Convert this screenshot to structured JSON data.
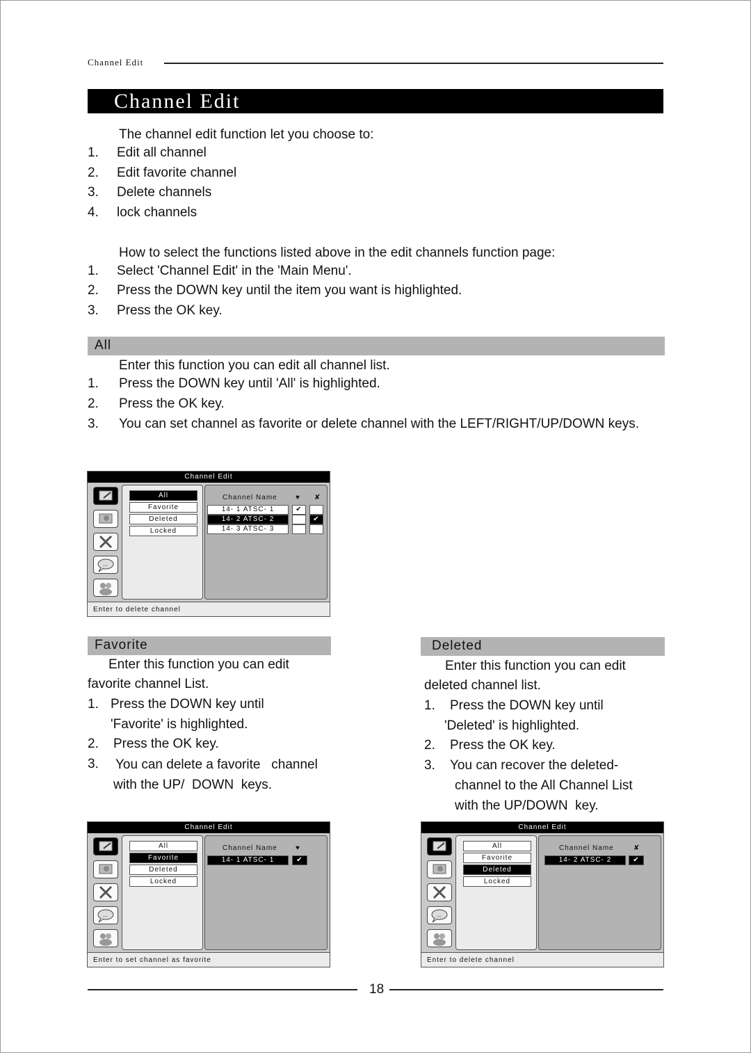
{
  "running_head": "Channel Edit",
  "title": "Channel Edit",
  "intro": {
    "lead": "The channel edit function let you choose to:",
    "items": [
      {
        "n": "1.",
        "text": "Edit all channel"
      },
      {
        "n": "2.",
        "text": "Edit favorite channel"
      },
      {
        "n": "3.",
        "text": "Delete channels"
      },
      {
        "n": "4.",
        "text": "lock channels"
      }
    ]
  },
  "howto": {
    "lead": "How to select the functions listed above in the edit channels function page:",
    "items": [
      {
        "n": "1.",
        "text": "Select 'Channel Edit' in the 'Main Menu'."
      },
      {
        "n": "2.",
        "text": "Press the  DOWN  key until the item you want is highlighted."
      },
      {
        "n": "3.",
        "text": "Press the OK key."
      }
    ]
  },
  "all_section": {
    "heading": "All",
    "lead": "Enter this function you can edit all channel list.",
    "items": [
      {
        "n": "1.",
        "text": "Press the DOWN  key until 'All' is highlighted."
      },
      {
        "n": "2.",
        "text": "Press the OK key."
      },
      {
        "n": "3.",
        "text": "You can set channel as favorite or delete channel with the LEFT/RIGHT/UP/DOWN keys."
      }
    ]
  },
  "favorite_section": {
    "heading": "Favorite",
    "lines": [
      "Enter this function you can edit",
      "favorite channel List.",
      "Press the DOWN key until",
      "'Favorite' is highlighted.",
      "Press the OK key.",
      "You can delete a favorite   channel",
      "with the UP/  DOWN  keys."
    ],
    "nums": [
      "1.",
      "2.",
      "3."
    ]
  },
  "deleted_section": {
    "heading": "Deleted",
    "lines": [
      "Enter this function you can edit",
      "deleted channel list.",
      "Press the DOWN key until",
      "'Deleted' is highlighted.",
      "Press the OK key.",
      "You can recover the deleted-",
      "channel to the All Channel List",
      "with the UP/DOWN  key."
    ],
    "nums": [
      "1.",
      "2.",
      "3."
    ]
  },
  "osd_common": {
    "title": "Channel Edit",
    "menu": [
      "All",
      "Favorite",
      "Deleted",
      "Locked"
    ],
    "column_header": "Channel Name",
    "favorite_icon": "♥",
    "delete_icon": "✘",
    "check": "✔",
    "side_icons": [
      "edit-icon",
      "tv-icon",
      "tools-icon",
      "chat-icon",
      "users-icon"
    ]
  },
  "osd_all": {
    "selected_menu": "All",
    "channels": [
      {
        "name": "14- 1  ATSC- 1",
        "favorite": true,
        "deleted": false,
        "selected": false
      },
      {
        "name": "14- 2  ATSC- 2",
        "favorite": false,
        "deleted": true,
        "selected": true
      },
      {
        "name": "14- 3  ATSC- 3",
        "favorite": false,
        "deleted": false,
        "selected": false
      }
    ],
    "status": "Enter to delete channel"
  },
  "osd_favorite": {
    "selected_menu": "Favorite",
    "channels": [
      {
        "name": "14- 1  ATSC- 1",
        "favorite": true,
        "selected": true
      }
    ],
    "status": "Enter to set channel as favorite"
  },
  "osd_deleted": {
    "selected_menu": "Deleted",
    "channels": [
      {
        "name": "14- 2  ATSC- 2",
        "deleted": true,
        "selected": true
      }
    ],
    "status": "Enter to delete channel"
  },
  "page_number": "18"
}
